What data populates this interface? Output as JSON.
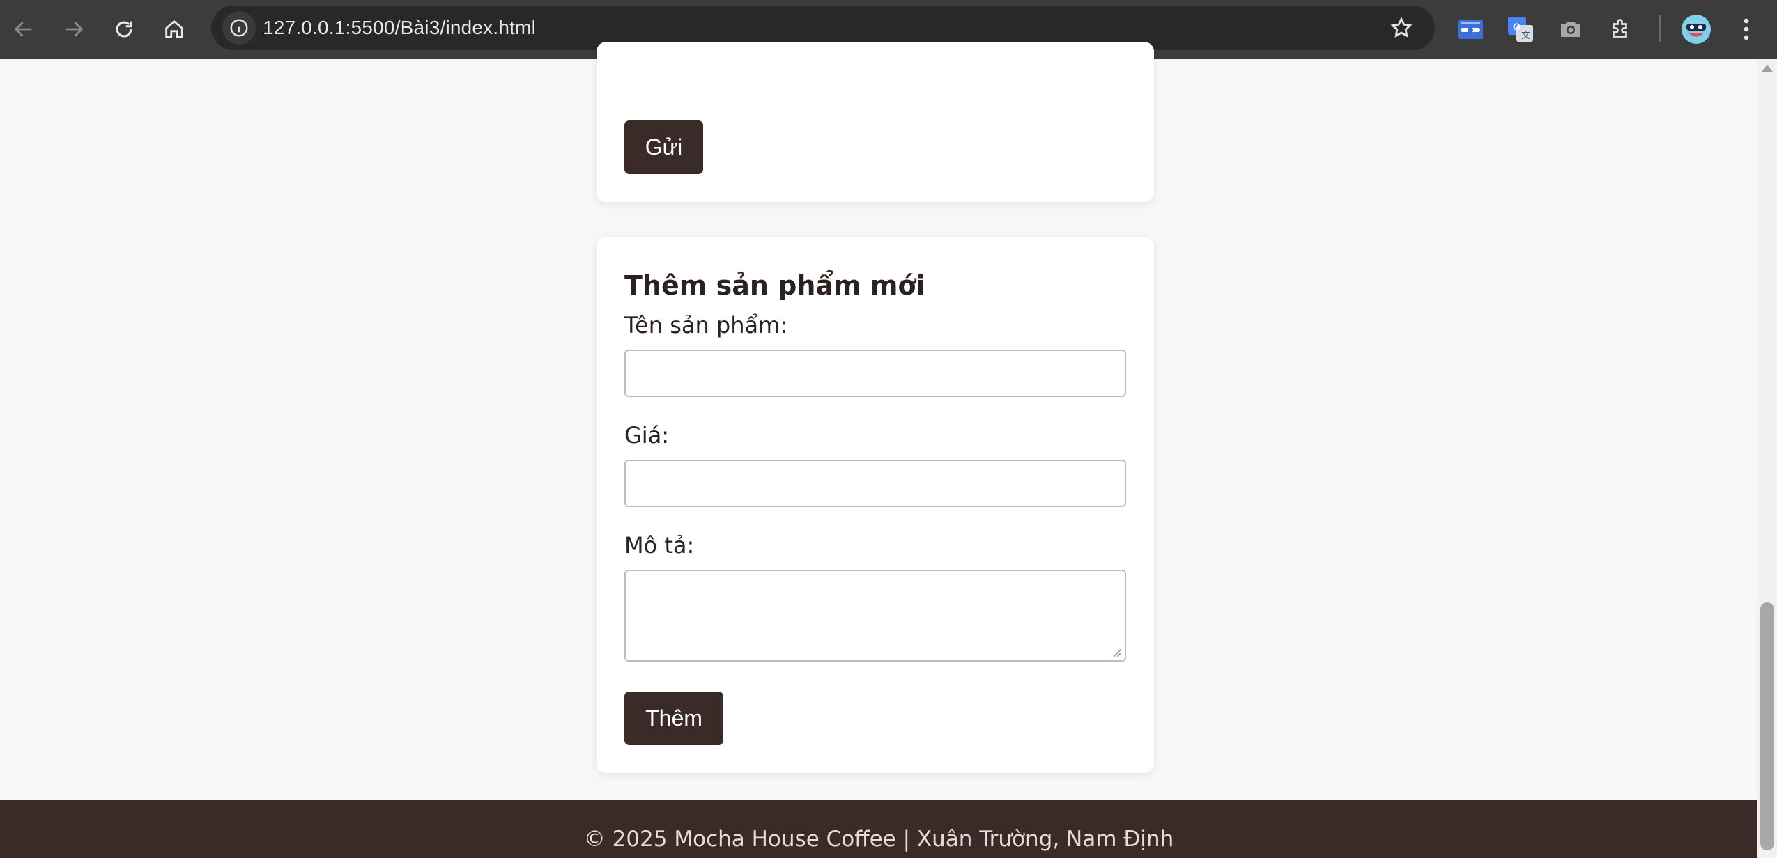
{
  "browser": {
    "url": "127.0.0.1:5500/Bài3/index.html",
    "icons": {
      "back": "back-arrow-icon",
      "forward": "forward-arrow-icon",
      "reload": "reload-icon",
      "home": "home-icon",
      "site_info": "info-icon",
      "bookmark": "star-icon",
      "extensions": [
        "password-manager-icon",
        "google-translate-icon",
        "camera-icon",
        "puzzle-icon"
      ],
      "profile": "avatar",
      "menu": "kebab-menu-icon"
    }
  },
  "top_card": {
    "submit_label": "Gửi"
  },
  "add_product": {
    "title": "Thêm sản phẩm mới",
    "name_label": "Tên sản phẩm:",
    "name_value": "",
    "price_label": "Giá:",
    "price_value": "",
    "description_label": "Mô tả:",
    "description_value": "",
    "submit_label": "Thêm"
  },
  "footer": {
    "text": "© 2025 Mocha House Coffee | Xuân Trường, Nam Định"
  },
  "colors": {
    "accent_dark": "#3b2b28",
    "page_bg": "#f7f7f7",
    "card_bg": "#ffffff",
    "chrome_bg": "#3c3c3c"
  }
}
